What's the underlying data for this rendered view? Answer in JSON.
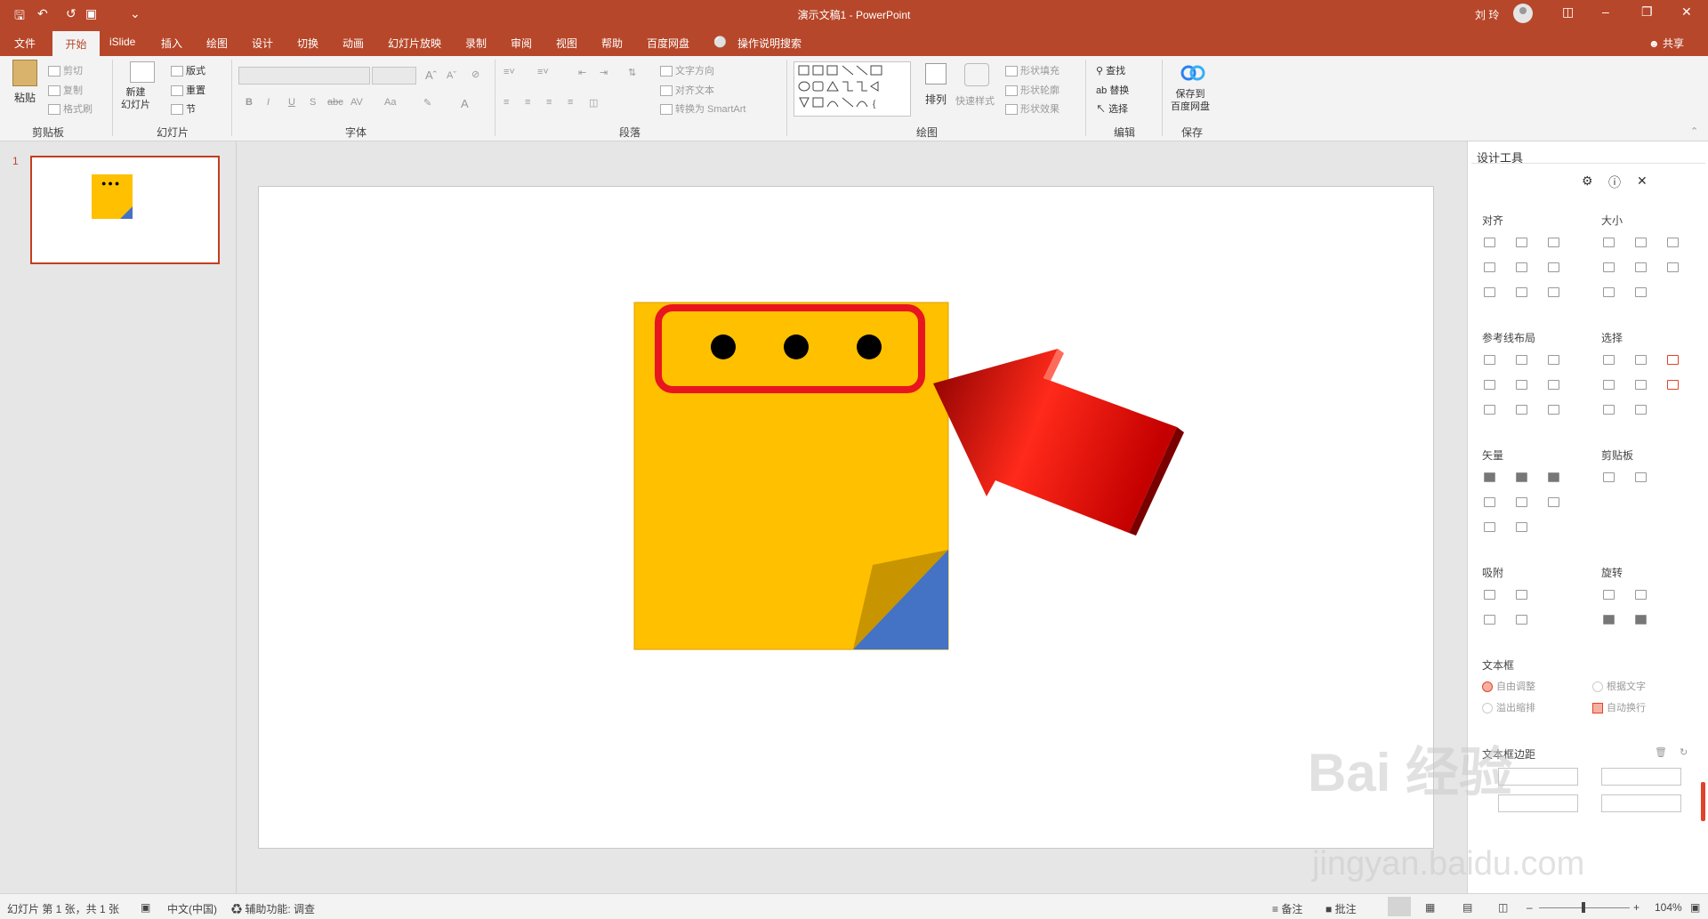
{
  "window": {
    "title": "演示文稿1  -  PowerPoint",
    "user": "刘 玲"
  },
  "ribbon_tabs": [
    "文件",
    "开始",
    "iSlide",
    "插入",
    "绘图",
    "设计",
    "切换",
    "动画",
    "幻灯片放映",
    "录制",
    "审阅",
    "视图",
    "帮助",
    "百度网盘",
    "操作说明搜索"
  ],
  "share": "共享",
  "clipboard": {
    "paste": "粘贴",
    "cut": "剪切",
    "copy": "复制",
    "format": "格式刷",
    "label": "剪贴板"
  },
  "slides": {
    "new": "新建\n幻灯片",
    "layout": "版式",
    "reset": "重置",
    "section": "节",
    "label": "幻灯片"
  },
  "font": {
    "label": "字体",
    "bold": "B",
    "italic": "I",
    "underline": "U",
    "shadow": "S",
    "strike": "abc",
    "aa": "Aa",
    "A": "A"
  },
  "paragraph": {
    "label": "段落",
    "text_dir": "文字方向",
    "align_text": "对齐文本",
    "smartart": "转换为 SmartArt"
  },
  "drawing": {
    "label": "绘图",
    "arrange": "排列",
    "quick": "快速样式",
    "fill": "形状填充",
    "outline": "形状轮廓",
    "effect": "形状效果"
  },
  "editing": {
    "label": "编辑",
    "find": "查找",
    "replace": "替换",
    "select": "选择"
  },
  "save": {
    "label": "保存",
    "btn": "保存到\n百度网盘"
  },
  "thumb_number": "1",
  "design": {
    "title": "设计工具",
    "align": "对齐",
    "size": "大小",
    "guides": "参考线布局",
    "select": "选择",
    "vector": "矢量",
    "clipboard": "剪贴板",
    "snap": "吸附",
    "rotate": "旋转",
    "textbox": "文本框",
    "auto": "自由调整",
    "fit": "根据文字",
    "overflow": "溢出缩排",
    "wrap": "自动换行",
    "margin": "文本框边距"
  },
  "status": {
    "slide": "幻灯片 第 1 张，共 1 张",
    "lang": "中文(中国)",
    "access": "辅助功能: 调查",
    "notes": "备注",
    "comments": "批注",
    "zoom": "104%"
  },
  "watermark": {
    "main": "Bai 经验",
    "sub": "jingyan.baidu.com"
  },
  "colors": {
    "accent": "#b7472a",
    "note": "#ffc000",
    "fold": "#4472c4",
    "arrow": "#e31b1b"
  }
}
